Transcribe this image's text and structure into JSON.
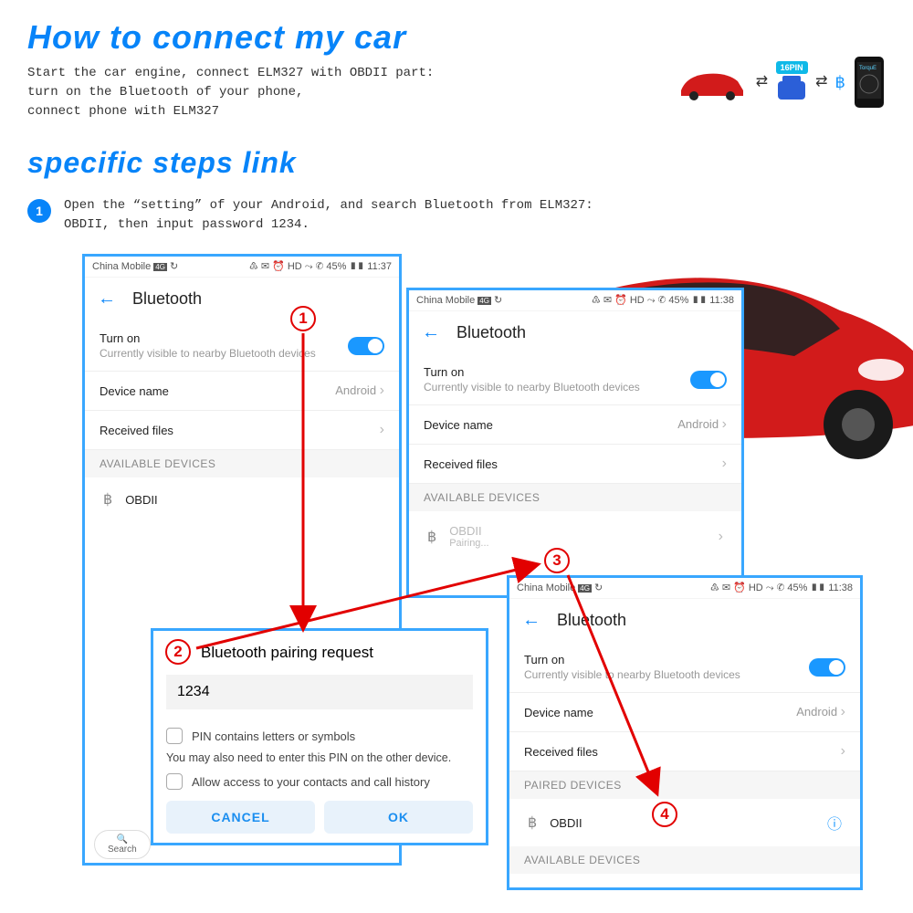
{
  "title1": "How to connect my car",
  "intro_line1": "Start the car engine, connect ELM327 with OBDII part:",
  "intro_line2": "turn on the Bluetooth of your phone,",
  "intro_line3": "connect phone with ELM327",
  "diagram": {
    "pin_label": "16PIN"
  },
  "title2": "specific steps link",
  "step_bullet": "1",
  "step_text": "Open the “setting” of your Android, and search Bluetooth from ELM327: OBDII, then input password 1234.",
  "annotations": {
    "c1": "1",
    "c2": "2",
    "c3": "3",
    "c4": "4"
  },
  "status": {
    "carrier": "China Mobile",
    "icons": "♳ ✉ ⏰ HD ⤳ ✆ 45%",
    "time1": "11:37",
    "time2": "11:38",
    "time3": "11:38"
  },
  "bt": {
    "title": "Bluetooth",
    "turn_on": "Turn on",
    "visible": "Currently visible to nearby Bluetooth devices",
    "device_name_label": "Device name",
    "device_name_value": "Android",
    "received": "Received files",
    "available": "AVAILABLE DEVICES",
    "paired": "PAIRED DEVICES",
    "obd": "OBDII",
    "pairing": "Pairing...",
    "search": "Search"
  },
  "dialog": {
    "title": "Bluetooth pairing request",
    "pin": "1234",
    "cb1": "PIN contains letters or symbols",
    "hint": "You may also need to enter this PIN on the other device.",
    "cb2": "Allow access to your contacts and call history",
    "cancel": "CANCEL",
    "ok": "OK"
  }
}
